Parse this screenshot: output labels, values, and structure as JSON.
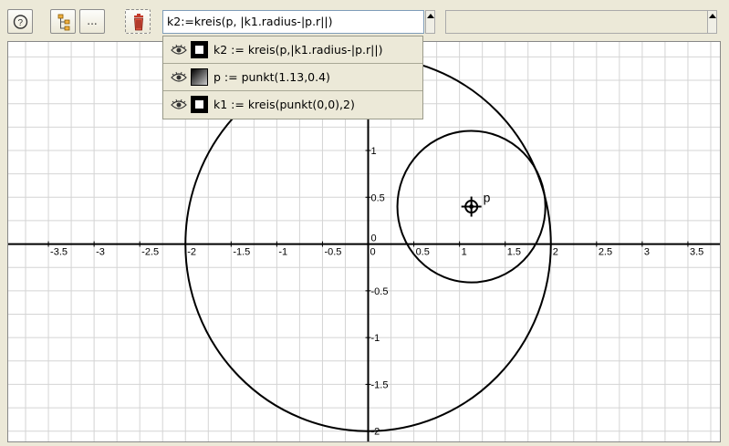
{
  "toolbar": {
    "help_icon": "question-circle",
    "tree_icon": "tree-hierarchy",
    "more_label": "...",
    "delete_icon": "trash-can"
  },
  "command_input": {
    "value": "k2:=kreis(p, |k1.radius-|p.r||)"
  },
  "info_field": {
    "value": ""
  },
  "history": [
    {
      "visible_icon": "eye",
      "color": "white-square",
      "text": "k2 := kreis(p,|k1.radius-|p.r||)"
    },
    {
      "visible_icon": "eye",
      "color": "gradient-square",
      "text": "p := punkt(1.13,0.4)"
    },
    {
      "visible_icon": "eye",
      "color": "white-square",
      "text": "k1 := kreis(punkt(0,0),2)"
    }
  ],
  "chart_data": {
    "type": "scatter",
    "xlim": [
      -3.94,
      3.85
    ],
    "ylim": [
      -2.11,
      2.16
    ],
    "grid": true,
    "x_ticks": [
      -3.5,
      -3,
      -2.5,
      -2,
      -1.5,
      -1,
      -0.5,
      0,
      0.5,
      1,
      1.5,
      2,
      2.5,
      3,
      3.5
    ],
    "x_tick_labels": [
      "-3.5",
      "-3",
      "-2.5",
      "-2",
      "-1.5",
      "-1",
      "-0.5",
      "0",
      "0.5",
      "1",
      "1.5",
      "2",
      "2.5",
      "3",
      "3.5"
    ],
    "y_ticks": [
      -2,
      -1.5,
      -1,
      -0.5,
      0.5,
      1
    ],
    "y_tick_labels": [
      "-2",
      "-1.5",
      "-1",
      "-0.5",
      "0.5",
      "1"
    ],
    "origin_label": "0",
    "points": [
      {
        "label": "p",
        "x": 1.13,
        "y": 0.4
      }
    ],
    "circles": [
      {
        "label": "k1",
        "cx": 0,
        "cy": 0,
        "r": 2
      },
      {
        "label": "k2",
        "cx": 1.13,
        "cy": 0.4,
        "r": 0.81
      }
    ]
  }
}
